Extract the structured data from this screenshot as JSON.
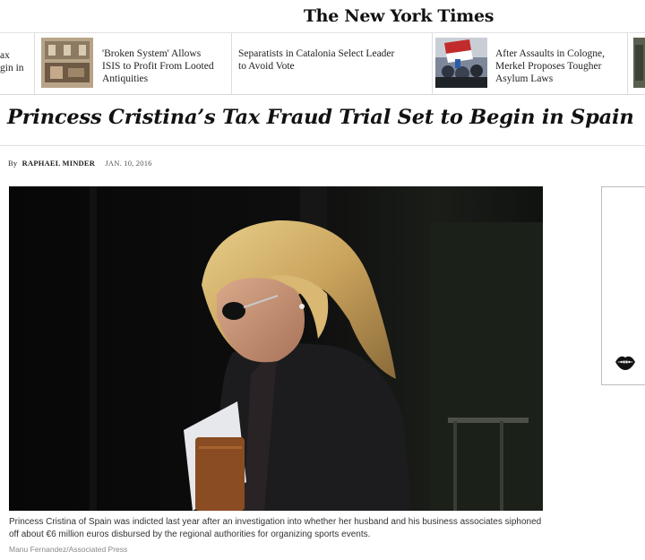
{
  "masthead": {
    "logo": "The New York Times"
  },
  "strip": {
    "items": [
      {
        "headline_lines": [
          "ax",
          "gin in"
        ]
      },
      {
        "headline_lines": [
          "'Broken System' Allows",
          "ISIS to Profit From Looted",
          "Antiquities"
        ]
      },
      {
        "headline_lines": [
          "Separatists in Catalonia Select Leader",
          "to Avoid Vote"
        ]
      },
      {
        "headline_lines": [
          "After Assaults in Cologne,",
          "Merkel Proposes Tougher",
          "Asylum Laws"
        ]
      }
    ]
  },
  "article": {
    "headline": "Princess Cristina’s Tax Fraud Trial Set to Begin in Spain",
    "byline_prefix": "By",
    "author": "RAPHAEL MINDER",
    "date": "JAN. 10, 2016",
    "caption": "Princess Cristina of Spain was indicted last year after an investigation into whether her husband and his business associates siphoned off about €6 million euros disbursed by the regional authorities for organizing sports events.",
    "credit": "Manu Fernandez/Associated Press"
  }
}
